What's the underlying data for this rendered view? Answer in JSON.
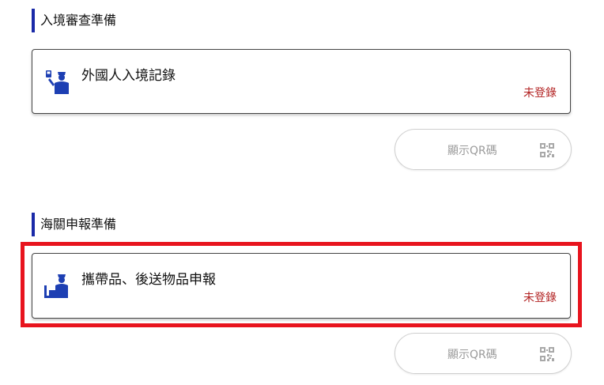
{
  "sections": [
    {
      "title": "入境審查準備",
      "card": {
        "label": "外國人入境記錄",
        "status": "未登錄",
        "icon": "immigration-officer-icon"
      },
      "qr_button": {
        "label": "顯示QR碼",
        "icon": "qr-code-icon"
      }
    },
    {
      "title": "海關申報準備",
      "card": {
        "label": "攜帶品、後送物品申報",
        "status": "未登錄",
        "icon": "customs-officer-icon"
      },
      "qr_button": {
        "label": "顯示QR碼",
        "icon": "qr-code-icon"
      }
    }
  ],
  "colors": {
    "accent_bar": "#1a2aa8",
    "status_red": "#b22222",
    "icon_blue": "#1d3fb3",
    "highlight_red": "#e8141e"
  }
}
